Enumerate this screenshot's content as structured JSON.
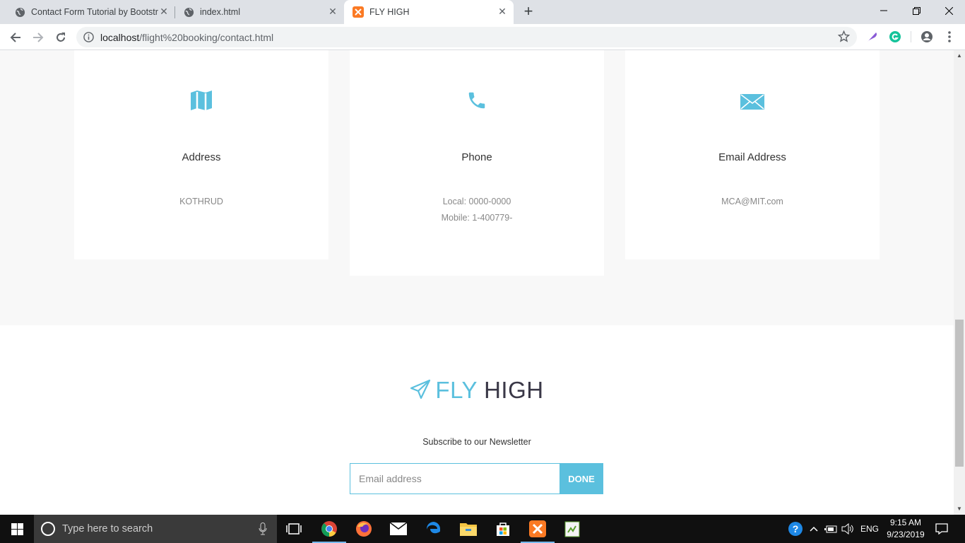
{
  "browser": {
    "tabs": [
      {
        "title": "Contact Form Tutorial by Bootstrap",
        "active": false
      },
      {
        "title": "index.html",
        "active": false
      },
      {
        "title": "FLY HIGH",
        "active": true
      }
    ],
    "url_host": "localhost",
    "url_path": "/flight%20booking/contact.html"
  },
  "contact": {
    "cards": [
      {
        "icon": "map-icon",
        "title": "Address",
        "lines": [
          "KOTHRUD"
        ]
      },
      {
        "icon": "phone-icon",
        "title": "Phone",
        "lines": [
          "Local: 0000-0000",
          "Mobile: 1-400779-"
        ]
      },
      {
        "icon": "envelope-icon",
        "title": "Email Address",
        "lines": [
          "MCA@MIT.com"
        ]
      }
    ]
  },
  "footer": {
    "brand_fly": "FLY",
    "brand_high": "HIGH",
    "newsletter_label": "Subscribe to our Newsletter",
    "email_placeholder": "Email address",
    "done_label": "DONE"
  },
  "taskbar": {
    "search_placeholder": "Type here to search",
    "language": "ENG",
    "time": "9:15 AM",
    "date": "9/23/2019"
  },
  "colors": {
    "accent": "#5bc0de",
    "brand_dark": "#3a3847",
    "section_bg": "#f8f8f8"
  }
}
